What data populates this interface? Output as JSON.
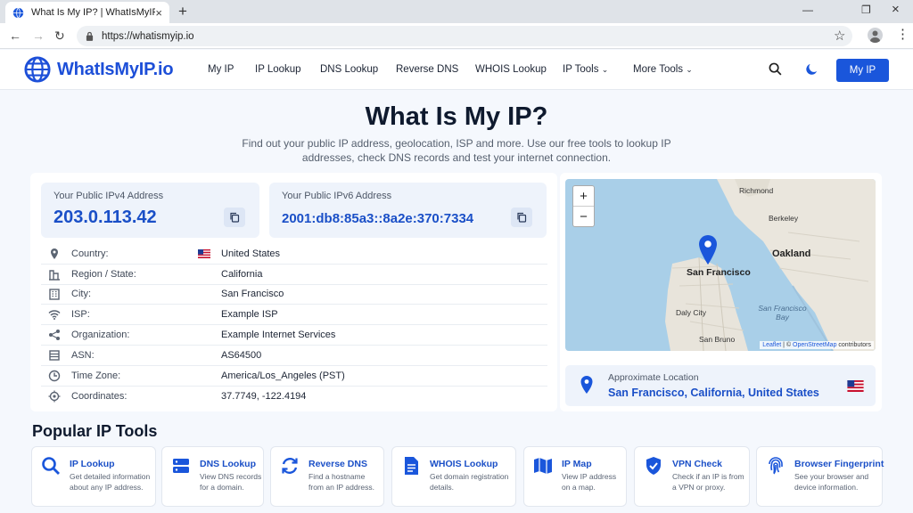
{
  "browser": {
    "tab_title": "What Is My IP? | WhatIsMyIP.io",
    "url": "https://whatismyip.io"
  },
  "header": {
    "brand": "WhatIsMyIP.io",
    "nav": [
      "My IP",
      "IP Lookup",
      "DNS Lookup",
      "Reverse DNS",
      "WHOIS Lookup",
      "IP Tools",
      "More Tools"
    ],
    "cta": "My IP"
  },
  "hero": {
    "title": "What Is My IP?",
    "subtitle": "Find out your public IP address, geolocation, ISP and more. Use our free tools to lookup IP addresses, check DNS records and test your internet connection."
  },
  "ipv4": {
    "label": "Your Public IPv4 Address",
    "value": "203.0.113.42"
  },
  "ipv6": {
    "label": "Your Public IPv6 Address",
    "value": "2001:db8:85a3::8a2e:370:7334"
  },
  "details": [
    {
      "key": "Country:",
      "value": "United States",
      "icon": "map-pin-icon"
    },
    {
      "key": "Region / State:",
      "value": "California",
      "icon": "region-icon"
    },
    {
      "key": "City:",
      "value": "San Francisco",
      "icon": "city-icon"
    },
    {
      "key": "ISP:",
      "value": "Example ISP",
      "icon": "wifi-icon"
    },
    {
      "key": "Organization:",
      "value": "Example Internet Services",
      "icon": "share-icon"
    },
    {
      "key": "ASN:",
      "value": "AS64500",
      "icon": "server-icon"
    },
    {
      "key": "Time Zone:",
      "value": "America/Los_Angeles (PST)",
      "icon": "clock-icon"
    },
    {
      "key": "Coordinates:",
      "value": "37.7749, -122.4194",
      "icon": "target-icon"
    }
  ],
  "map": {
    "labels": [
      "Richmond",
      "Berkeley",
      "Oakland",
      "San Francisco",
      "Daly City",
      "San Francisco Bay",
      "San Bruno"
    ],
    "attribution_a": "Leaflet",
    "attribution_b": " | © ",
    "attribution_c": "OpenStreetMap",
    "attribution_d": " contributors",
    "zoom_in": "+",
    "zoom_out": "−"
  },
  "approx": {
    "label": "Approximate Location",
    "value": "San Francisco, California, United States"
  },
  "tools": {
    "heading": "Popular IP Tools",
    "items": [
      {
        "name": "IP Lookup",
        "desc": "Get detailed information about any IP address."
      },
      {
        "name": "DNS Lookup",
        "desc": "View DNS records for a domain."
      },
      {
        "name": "Reverse DNS",
        "desc": "Find a hostname from an IP address."
      },
      {
        "name": "WHOIS Lookup",
        "desc": "Get domain registration details."
      },
      {
        "name": "IP Map",
        "desc": "View IP address on a map."
      },
      {
        "name": "VPN Check",
        "desc": "Check if an IP is from a VPN or proxy."
      },
      {
        "name": "Browser Fingerprint",
        "desc": "See your browser and device information."
      }
    ]
  },
  "colors": {
    "accent": "#1a56db",
    "link": "#1a4fc7",
    "background": "#f5f8fd"
  }
}
